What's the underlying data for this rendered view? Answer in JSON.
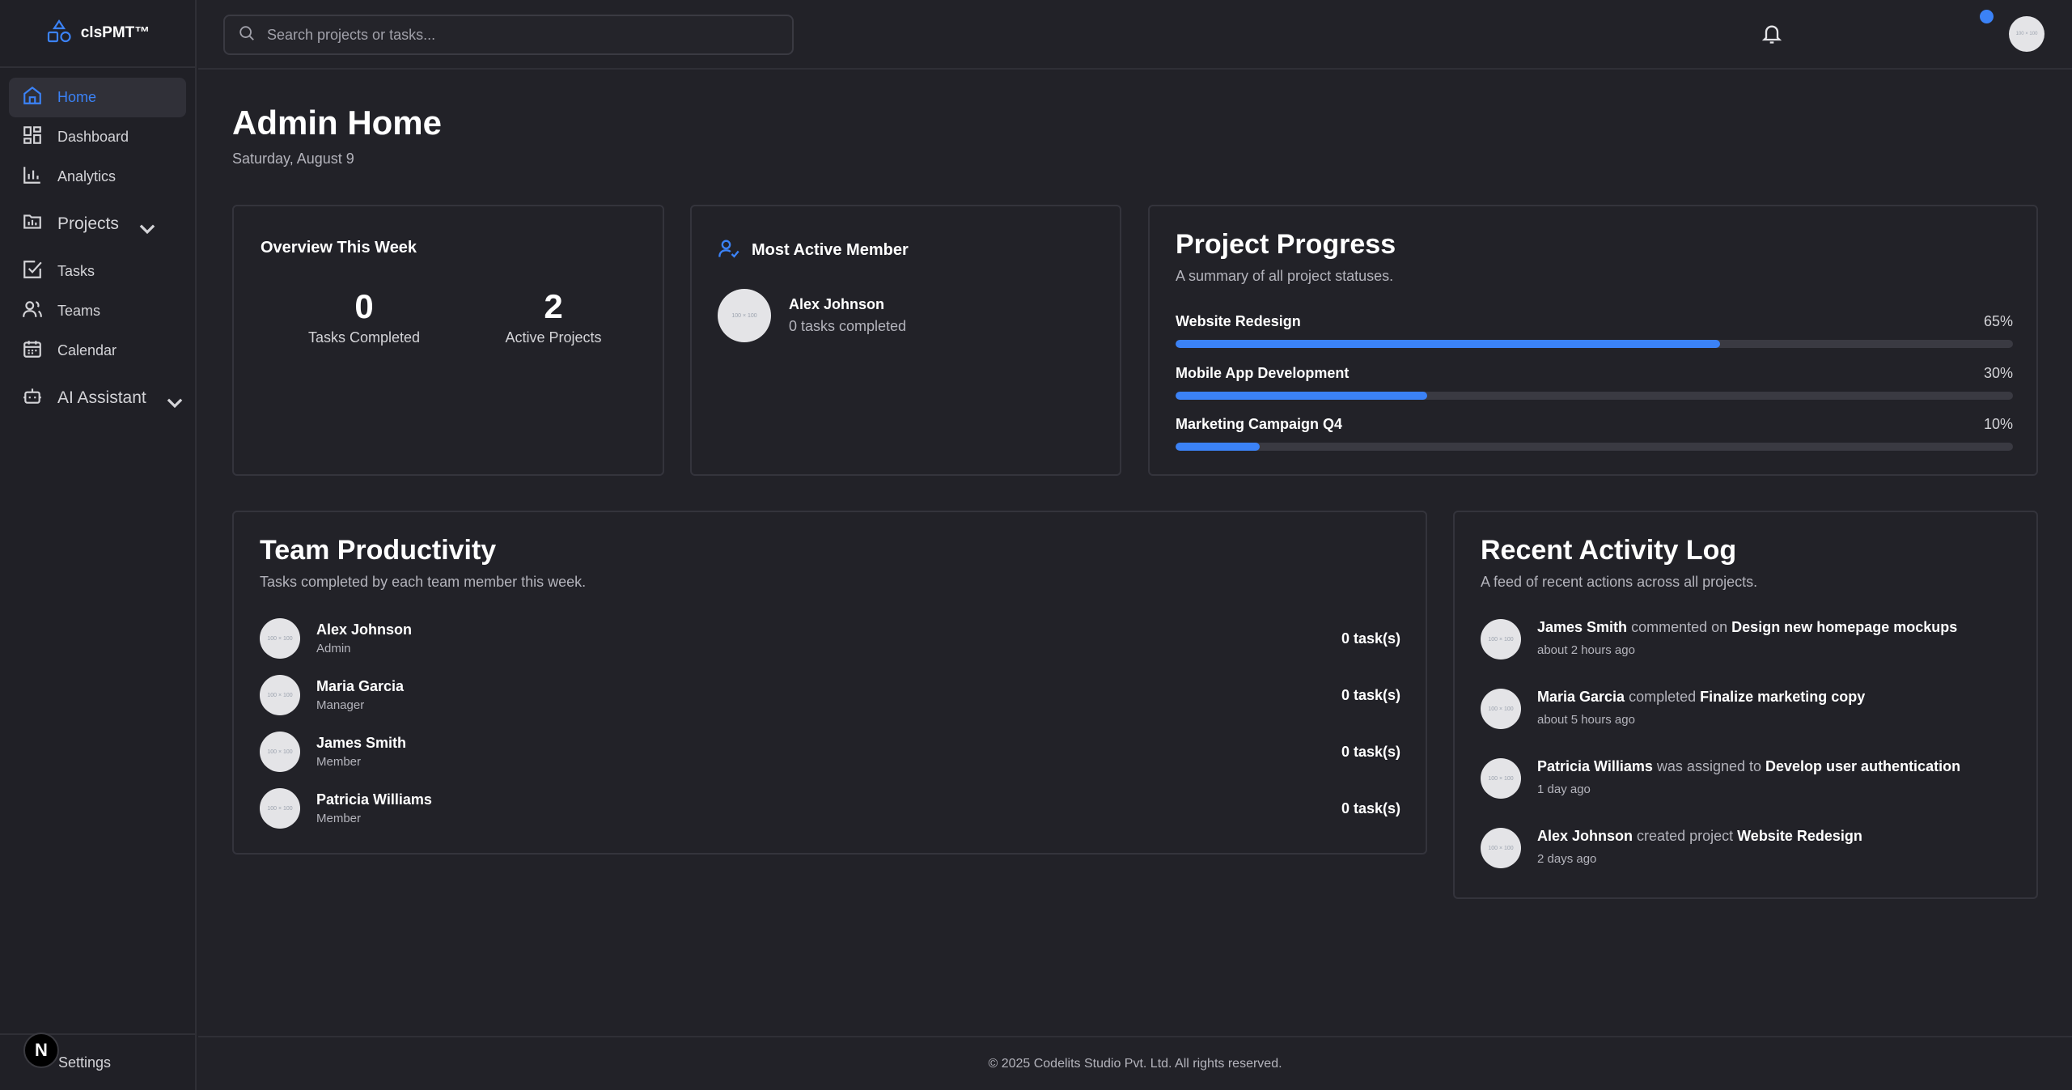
{
  "brand": {
    "name": "clsPMT™"
  },
  "sidebar": {
    "items": [
      {
        "label": "Home"
      },
      {
        "label": "Dashboard"
      },
      {
        "label": "Analytics"
      },
      {
        "label": "Projects"
      },
      {
        "label": "Tasks"
      },
      {
        "label": "Teams"
      },
      {
        "label": "Calendar"
      },
      {
        "label": "AI Assistant"
      }
    ],
    "settings_label": "Settings",
    "n_badge": "N"
  },
  "header": {
    "search_placeholder": "Search projects or tasks...",
    "avatar_text": "100 × 100"
  },
  "page": {
    "title": "Admin Home",
    "date": "Saturday, August 9"
  },
  "overview": {
    "title": "Overview This Week",
    "tasks_completed_value": "0",
    "tasks_completed_label": "Tasks Completed",
    "active_projects_value": "2",
    "active_projects_label": "Active Projects"
  },
  "most_active": {
    "title": "Most Active Member",
    "name": "Alex Johnson",
    "detail": "0 tasks completed",
    "avatar_text": "100 × 100"
  },
  "project_progress": {
    "title": "Project Progress",
    "subtitle": "A summary of all project statuses.",
    "projects": [
      {
        "name": "Website Redesign",
        "pct_label": "65%",
        "pct": 65
      },
      {
        "name": "Mobile App Development",
        "pct_label": "30%",
        "pct": 30
      },
      {
        "name": "Marketing Campaign Q4",
        "pct_label": "10%",
        "pct": 10
      }
    ]
  },
  "team_productivity": {
    "title": "Team Productivity",
    "subtitle": "Tasks completed by each team member this week.",
    "members": [
      {
        "name": "Alex Johnson",
        "role": "Admin",
        "count": "0 task(s)",
        "avatar": "100 × 100"
      },
      {
        "name": "Maria Garcia",
        "role": "Manager",
        "count": "0 task(s)",
        "avatar": "100 × 100"
      },
      {
        "name": "James Smith",
        "role": "Member",
        "count": "0 task(s)",
        "avatar": "100 × 100"
      },
      {
        "name": "Patricia Williams",
        "role": "Member",
        "count": "0 task(s)",
        "avatar": "100 × 100"
      }
    ]
  },
  "activity": {
    "title": "Recent Activity Log",
    "subtitle": "A feed of recent actions across all projects.",
    "items": [
      {
        "actor": "James Smith",
        "verb": "commented on",
        "target": "Design new homepage mockups",
        "time": "about 2 hours ago",
        "avatar": "100 × 100"
      },
      {
        "actor": "Maria Garcia",
        "verb": "completed",
        "target": "Finalize marketing copy",
        "time": "about 5 hours ago",
        "avatar": "100 × 100"
      },
      {
        "actor": "Patricia Williams",
        "verb": "was assigned to",
        "target": "Develop user authentication",
        "time": "1 day ago",
        "avatar": "100 × 100"
      },
      {
        "actor": "Alex Johnson",
        "verb": "created project",
        "target": "Website Redesign",
        "time": "2 days ago",
        "avatar": "100 × 100"
      }
    ]
  },
  "footer": {
    "text": "© 2025 Codelits Studio Pvt. Ltd. All rights reserved."
  },
  "colors": {
    "accent": "#3b82f6",
    "background": "#222228",
    "sidebar": "#202026"
  }
}
